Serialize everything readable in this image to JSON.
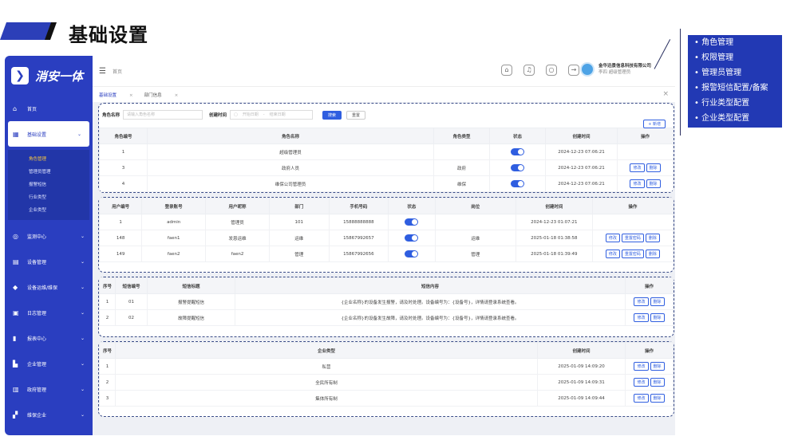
{
  "header": {
    "title": "基础设置"
  },
  "app": {
    "logo_text": "消安一体"
  },
  "sidebar": {
    "items": [
      {
        "label": "首页",
        "icon": "home-icon"
      },
      {
        "label": "基础设置",
        "icon": "grid-icon",
        "open": true,
        "subs": [
          "角色管理",
          "管理员管理",
          "报警短信",
          "行业类型",
          "企业类型"
        ]
      },
      {
        "label": "监测中心",
        "icon": "monitor-icon"
      },
      {
        "label": "设备管理",
        "icon": "device-icon"
      },
      {
        "label": "设备运维/维保",
        "icon": "shield-icon"
      },
      {
        "label": "日志管理",
        "icon": "log-icon"
      },
      {
        "label": "报表中心",
        "icon": "chart-icon"
      },
      {
        "label": "企业管理",
        "icon": "building-icon"
      },
      {
        "label": "政府管理",
        "icon": "gov-icon"
      },
      {
        "label": "维保企业",
        "icon": "maint-icon"
      }
    ]
  },
  "topbar": {
    "breadcrumb": "首页",
    "company": "金华迅景信息科技有限公司",
    "role": "李四  超级管理员"
  },
  "tabs": [
    {
      "label": "基础设置"
    },
    {
      "label": "部门信息"
    }
  ],
  "role_panel": {
    "search": {
      "name_label": "角色名称",
      "name_placeholder": "请输入角色名称",
      "date_label": "创建时间",
      "date_start": "开始日期",
      "date_sep": "-",
      "date_end": "结束日期",
      "search_btn": "搜索",
      "reset_btn": "重置",
      "add_btn": "+ 新增"
    },
    "columns": [
      "角色编号",
      "角色名称",
      "角色类型",
      "状态",
      "创建时间",
      "操作"
    ],
    "rows": [
      {
        "id": "1",
        "name": "超级管理员",
        "type": "",
        "time": "2024-12-23 07:06:21",
        "ops": []
      },
      {
        "id": "3",
        "name": "政府人员",
        "type": "政府",
        "time": "2024-12-23 07:06:21",
        "ops": [
          "修改",
          "删除"
        ]
      },
      {
        "id": "4",
        "name": "维保公司管理员",
        "type": "维保",
        "time": "2024-12-23 07:06:21",
        "ops": [
          "修改",
          "删除"
        ]
      }
    ]
  },
  "user_panel": {
    "columns": [
      "用户编号",
      "登录账号",
      "用户昵称",
      "部门",
      "手机号码",
      "状态",
      "岗位",
      "创建时间",
      "操作"
    ],
    "rows": [
      {
        "id": "1",
        "account": "admin",
        "nick": "管理员",
        "dept": "101",
        "phone": "15888888888",
        "post": "",
        "time": "2024-12-23 01:07:21",
        "ops": []
      },
      {
        "id": "148",
        "account": "faen1",
        "nick": "发恩运维",
        "dept": "运维",
        "phone": "15867992657",
        "post": "运维",
        "time": "2025-01-18 01:38:58",
        "ops": [
          "修改",
          "重置密码",
          "删除"
        ]
      },
      {
        "id": "149",
        "account": "faen2",
        "nick": "faen2",
        "dept": "管理",
        "phone": "15867992656",
        "post": "管理",
        "time": "2025-01-18 01:39:49",
        "ops": [
          "修改",
          "重置密码",
          "删除"
        ]
      }
    ]
  },
  "sms_panel": {
    "columns": [
      "序号",
      "短信编号",
      "短信标题",
      "短信内容",
      "操作"
    ],
    "rows": [
      {
        "no": "1",
        "code": "01",
        "title": "报警提醒短信",
        "content": "{企业名称}的设备发生报警，请及时处理。设备编号为：{设备号}，详情请登录系统查看。",
        "ops": [
          "修改",
          "删除"
        ]
      },
      {
        "no": "2",
        "code": "02",
        "title": "故障提醒短信",
        "content": "{企业名称}的设备发生故障，请及时处理。设备编号为：{设备号}，详情请登录系统查看。",
        "ops": [
          "修改",
          "删除"
        ]
      }
    ]
  },
  "ent_panel": {
    "columns": [
      "序号",
      "企业类型",
      "创建时间",
      "操作"
    ],
    "rows": [
      {
        "no": "1",
        "type": "私营",
        "time": "2025-01-09 14:09:20",
        "ops": [
          "修改",
          "删除"
        ]
      },
      {
        "no": "2",
        "type": "全民所有制",
        "time": "2025-01-09 14:09:31",
        "ops": [
          "修改",
          "删除"
        ]
      },
      {
        "no": "3",
        "type": "集体所有制",
        "time": "2025-01-09 14:09:44",
        "ops": [
          "修改",
          "删除"
        ]
      }
    ]
  },
  "callout": {
    "items": [
      "角色管理",
      "权限管理",
      "管理员管理",
      "报警短信配置/备案",
      "行业类型配置",
      "企业类型配置"
    ]
  },
  "colors": {
    "primary": "#2a3ec0",
    "toggle": "#2f5ee0",
    "callout": "#2239b4"
  }
}
